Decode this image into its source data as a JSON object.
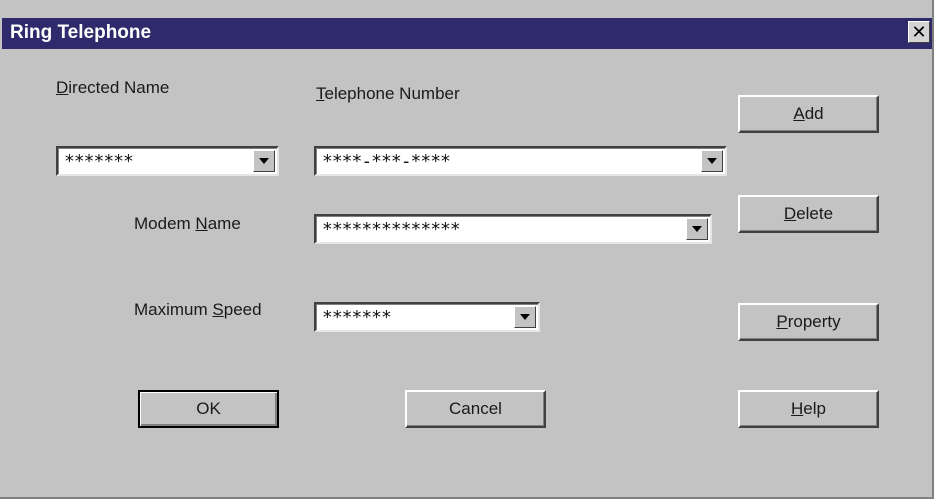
{
  "window": {
    "title": "Ring Telephone",
    "close_glyph": "✕"
  },
  "labels": {
    "directed_name": {
      "mnemonic": "D",
      "rest": "irected Name"
    },
    "telephone_number": {
      "mnemonic": "T",
      "rest": "elephone Number"
    },
    "modem_name": {
      "pre": "Modem ",
      "mnemonic": "N",
      "rest": "ame"
    },
    "maximum_speed": {
      "pre": "Maximum ",
      "mnemonic": "S",
      "rest": "peed"
    }
  },
  "fields": {
    "directed_name": "*******",
    "telephone_number": "****-***-****",
    "modem_name": "**************",
    "maximum_speed": "*******"
  },
  "buttons": {
    "add": {
      "mnemonic": "A",
      "rest": "dd"
    },
    "delete": {
      "mnemonic": "D",
      "rest": "elete"
    },
    "property": {
      "mnemonic": "P",
      "rest": "roperty"
    },
    "ok": "OK",
    "cancel": "Cancel",
    "help": {
      "mnemonic": "H",
      "rest": "elp"
    }
  },
  "icons": {
    "close": "close-icon",
    "dropdown": "dropdown-arrow-icon"
  },
  "colors": {
    "titlebar": "#2f2a6b",
    "dialog_bg": "#c3c3c3"
  }
}
